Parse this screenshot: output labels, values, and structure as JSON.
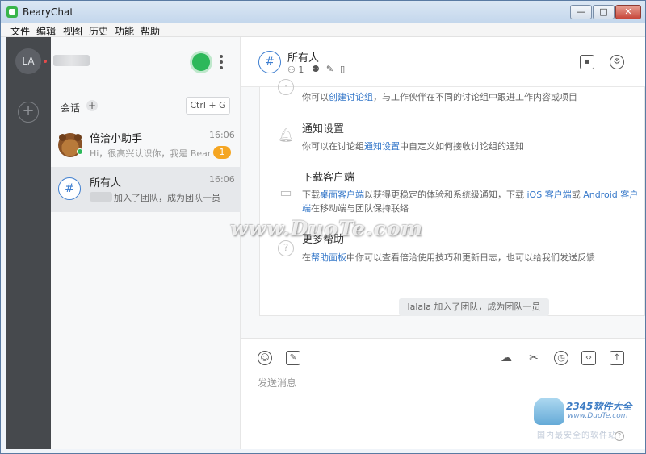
{
  "window": {
    "title": "BearyChat",
    "min": "—",
    "max": "□",
    "close": "✕"
  },
  "menu": [
    "文件",
    "编辑",
    "视图",
    "历史",
    "功能",
    "帮助"
  ],
  "rail": {
    "avatar": "LA",
    "add": "+"
  },
  "sidebar": {
    "conversations_label": "会话",
    "add": "+",
    "shortcut": "Ctrl + G",
    "items": [
      {
        "name": "倍洽小助手",
        "time": "16:06",
        "preview": "Hi，很高兴认识你，我是 BearyBot",
        "badge": "1",
        "avatar": "bear-icon"
      },
      {
        "name": "所有人",
        "time": "16:06",
        "preview": "加入了团队，成为团队一员",
        "avatar": "#"
      }
    ]
  },
  "channel": {
    "name": "所有人",
    "member_count": "1",
    "avatar": "#",
    "icons": [
      "person-icon",
      "robot-icon",
      "pin-icon",
      "file-icon"
    ],
    "header_actions": [
      "briefcase-icon",
      "gear-icon"
    ]
  },
  "help": {
    "item1": {
      "desc_prefix": "你可以",
      "link": "创建讨论组",
      "desc_suffix": "，与工作伙伴在不同的讨论组中跟进工作内容或项目"
    },
    "item2": {
      "title": "通知设置",
      "desc_prefix": "你可以在讨论组",
      "link": "通知设置",
      "desc_suffix": "中自定义如何接收讨论组的通知"
    },
    "item3": {
      "title": "下载客户端",
      "p1": "下载",
      "l1": "桌面客户端",
      "p2": "以获得更稳定的体验和系统级通知，下载 ",
      "l2": "iOS 客户端",
      "p3": "或 ",
      "l3": "Android 客户端",
      "p4": "在移动端与团队保持联络"
    },
    "item4": {
      "title": "更多帮助",
      "desc_prefix": "在",
      "link": "帮助面板",
      "desc_suffix": "中你可以查看倍洽使用技巧和更新日志，也可以给我们发送反馈"
    }
  },
  "system_message": "lalala 加入了团队，成为团队一员",
  "composer": {
    "placeholder": "发送消息",
    "left_icons": [
      "emoji-icon",
      "sticker-icon"
    ],
    "right_icons": [
      "cloud-icon",
      "scissors-icon",
      "alarm-icon",
      "code-icon",
      "upload-icon"
    ]
  },
  "watermark": {
    "text": "www.DuoTe.com",
    "brand": "2345软件大全",
    "url": "www.DuoTe.com",
    "slogan": "国内最安全的软件站"
  },
  "colors": {
    "rail": "#46494d",
    "accent": "#3477c9",
    "online": "#2db85a",
    "badge": "#f5a623"
  }
}
